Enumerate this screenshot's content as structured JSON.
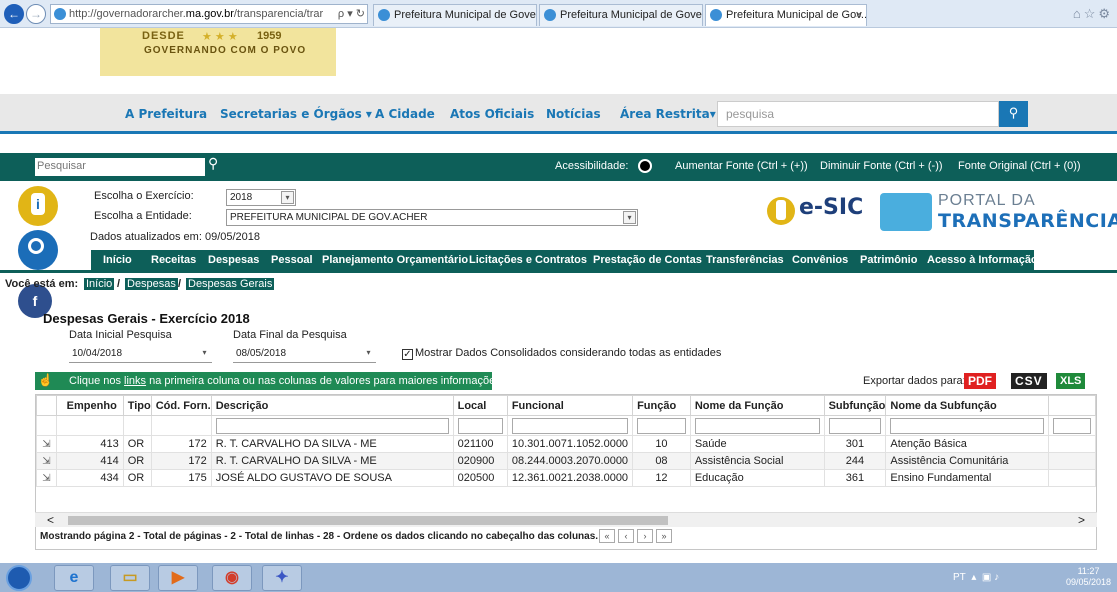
{
  "browser": {
    "url_prefix": "http://governadorarcher.",
    "url_domain": "ma.gov.br",
    "url_path": "/transparencia/trar",
    "url_ctrls": "ρ ▾ ↻",
    "tabs": [
      {
        "label": "Prefeitura Municipal de Gover...",
        "active": false
      },
      {
        "label": "Prefeitura Municipal de Gover...",
        "active": false
      },
      {
        "label": "Prefeitura Municipal de Gov...",
        "active": true
      }
    ],
    "tab_close": "×"
  },
  "banner": {
    "desde": "DESDE",
    "stars": "★ ★ ★",
    "year": "1959",
    "slogan": "GOVERNANDO COM O POVO"
  },
  "topnav": {
    "items": [
      "A Prefeitura",
      "Secretarias e Órgãos ▾",
      "A Cidade",
      "Atos Oficiais",
      "Notícias",
      "Área Restrita▾"
    ],
    "search_placeholder": "pesquisa"
  },
  "accessbar": {
    "search_placeholder": "Pesquisar",
    "acessibilidade": "Acessibilidade:",
    "aumentar": "Aumentar Fonte (Ctrl + (+))",
    "diminuir": "Diminuir Fonte (Ctrl + (-))",
    "original": "Fonte Original (Ctrl + (0))"
  },
  "selectors": {
    "exercicio_label": "Escolha o Exercício:",
    "exercicio_value": "2018",
    "entidade_label": "Escolha a Entidade:",
    "entidade_value": "PREFEITURA MUNICIPAL DE GOV.ACHER",
    "updated": "Dados atualizados em: 09/05/2018"
  },
  "logos": {
    "esic": "e-SIC",
    "portal_line1": "PORTAL DA",
    "portal_line2": "TRANSPARÊNCIA"
  },
  "mainmenu": [
    "Início",
    "Receitas",
    "Despesas",
    "Pessoal",
    "Planejamento Orçamentário",
    "Licitações e Contratos",
    "Prestação de Contas",
    "Transferências",
    "Convênios",
    "Patrimônio",
    "Acesso à Informação"
  ],
  "breadcrumb": {
    "prefix": "Você está em:",
    "items": [
      "Início",
      "Despesas",
      "Despesas Gerais"
    ],
    "sep": "/"
  },
  "page": {
    "title": "Despesas Gerais - Exercício 2018",
    "data_inicial_label": "Data Inicial Pesquisa",
    "data_inicial_value": "10/04/2018",
    "data_final_label": "Data Final da Pesquisa",
    "data_final_value": "08/05/2018",
    "consolidado_label": "Mostrar Dados Consolidados considerando todas as entidades",
    "consolidado_checked": "✓"
  },
  "infobar": {
    "text_before": "Clique nos ",
    "link": "links",
    "text_after": " na primeira coluna ou nas colunas de valores para maiores informações."
  },
  "export": {
    "label": "Exportar dados para:",
    "pdf": "PDF",
    "csv": "CSV",
    "xls": "XLS"
  },
  "table": {
    "headers": [
      "",
      "Empenho",
      "Tipo",
      "Cód. Forn.",
      "Descrição",
      "Local",
      "Funcional",
      "Função",
      "Nome da Função",
      "Subfunção",
      "Nome da Subfunção"
    ],
    "rows": [
      [
        "413",
        "OR",
        "172",
        "R. T. CARVALHO DA SILVA - ME",
        "021100",
        "10.301.0071.1052.0000",
        "10",
        "Saúde",
        "301",
        "Atenção Básica"
      ],
      [
        "414",
        "OR",
        "172",
        "R. T. CARVALHO DA SILVA - ME",
        "020900",
        "08.244.0003.2070.0000",
        "08",
        "Assistência Social",
        "244",
        "Assistência Comunitária"
      ],
      [
        "434",
        "OR",
        "175",
        "JOSÉ ALDO GUSTAVO DE SOUSA",
        "020500",
        "12.361.0021.2038.0000",
        "12",
        "Educação",
        "361",
        "Ensino Fundamental"
      ]
    ]
  },
  "pager": {
    "text": "Mostrando página 2 - Total de páginas - 2 - Total de linhas - 28 - Ordene os dados clicando no cabeçalho das colunas.",
    "first": "«",
    "prev": "‹",
    "next": "›",
    "last": "»"
  },
  "taskbar": {
    "lang": "PT",
    "time": "11:27",
    "date": "09/05/2018"
  },
  "colors": {
    "green": "#0d5f59",
    "blue": "#1a77b5",
    "info_green": "#1f8a55"
  }
}
